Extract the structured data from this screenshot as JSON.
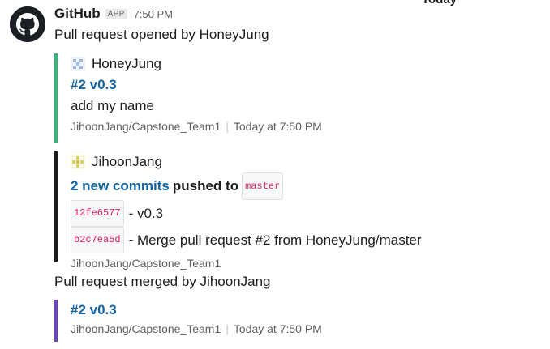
{
  "divider": {
    "label": "Today"
  },
  "message": {
    "app_name": "GitHub",
    "badge": "APP",
    "time": "7:50 PM",
    "avatar_icon": "github-octocat-icon"
  },
  "opened_line": "Pull request opened by HoneyJung",
  "attachment_1": {
    "author": "HoneyJung",
    "title": "#2 v0.3",
    "body": "add my name",
    "repo": "JihoonJang/Capstone_Team1",
    "time": "Today at 7:50 PM",
    "bar_color": "#2eb67d"
  },
  "attachment_2": {
    "author": "JihoonJang",
    "commits_link": "2 new commits",
    "pushed_to": "pushed to",
    "branch": "master",
    "commits": [
      {
        "sha": "12fe6577",
        "message": "- v0.3"
      },
      {
        "sha": "b2c7ea5d",
        "message": "- Merge pull request #2 from HoneyJung/master"
      }
    ],
    "repo": "JihoonJang/Capstone_Team1",
    "bar_color": "#1d1c1d"
  },
  "merged_line": "Pull request merged by JihoonJang",
  "attachment_3": {
    "title": "#2 v0.3",
    "repo": "JihoonJang/Capstone_Team1",
    "time": "Today at 7:50 PM",
    "bar_color": "#6f42c1"
  }
}
